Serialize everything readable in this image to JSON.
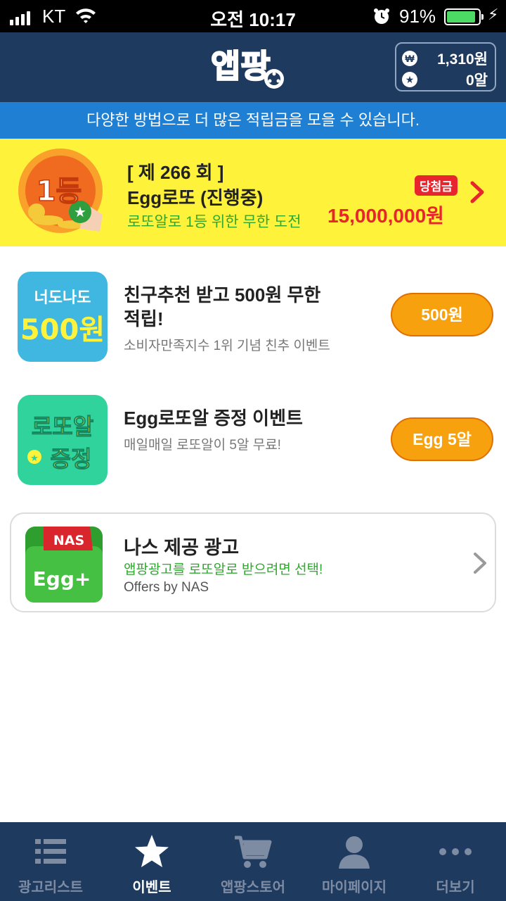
{
  "status_bar": {
    "carrier": "KT",
    "time": "오전 10:17",
    "battery_percent": "91%",
    "battery_level": 0.91
  },
  "header": {
    "logo_text": "앱팡",
    "balance_won": "1,310원",
    "balance_eggs": "0알",
    "won_symbol": "₩"
  },
  "notice": "다양한 방법으로 더 많은 적립금을 모을 수 있습니다.",
  "lotto_banner": {
    "icon_text": "1등",
    "round": "[ 제 266 회 ]",
    "title": "Egg로또 (진행중)",
    "description": "로또알로 1등 위한 무한 도전",
    "prize_label": "당첨금",
    "prize_amount": "15,000,000원"
  },
  "events": [
    {
      "thumb_line1": "너도나도",
      "thumb_line2": "500원",
      "title": "친구추천 받고 500원 무한적립!",
      "subtitle": "소비자만족지수 1위 기념 친추 이벤트",
      "button": "500원"
    },
    {
      "thumb_line1": "로또알",
      "thumb_line2": "증정",
      "title": "Egg로또알 증정 이벤트",
      "subtitle": "매일매일 로또알이 5알 무료!",
      "button": "Egg 5알"
    }
  ],
  "ad": {
    "thumb_badge": "NAS",
    "thumb_text": "Egg+",
    "title": "나스 제공 광고",
    "description": "앱팡광고를 로또알로 받으려면 선택!",
    "source": "Offers by NAS"
  },
  "tabs": [
    {
      "label": "광고리스트",
      "icon": "list-icon",
      "active": false
    },
    {
      "label": "이벤트",
      "icon": "star-icon",
      "active": true
    },
    {
      "label": "앱팡스토어",
      "icon": "cart-icon",
      "active": false
    },
    {
      "label": "마이페이지",
      "icon": "person-icon",
      "active": false
    },
    {
      "label": "더보기",
      "icon": "more-icon",
      "active": false
    }
  ],
  "colors": {
    "header_bg": "#1e3a5f",
    "notice_bg": "#1e7fd3",
    "banner_bg": "#fff23b",
    "prize_red": "#e8242c",
    "accent_green": "#2fa82f",
    "button_orange": "#f7a10e"
  }
}
